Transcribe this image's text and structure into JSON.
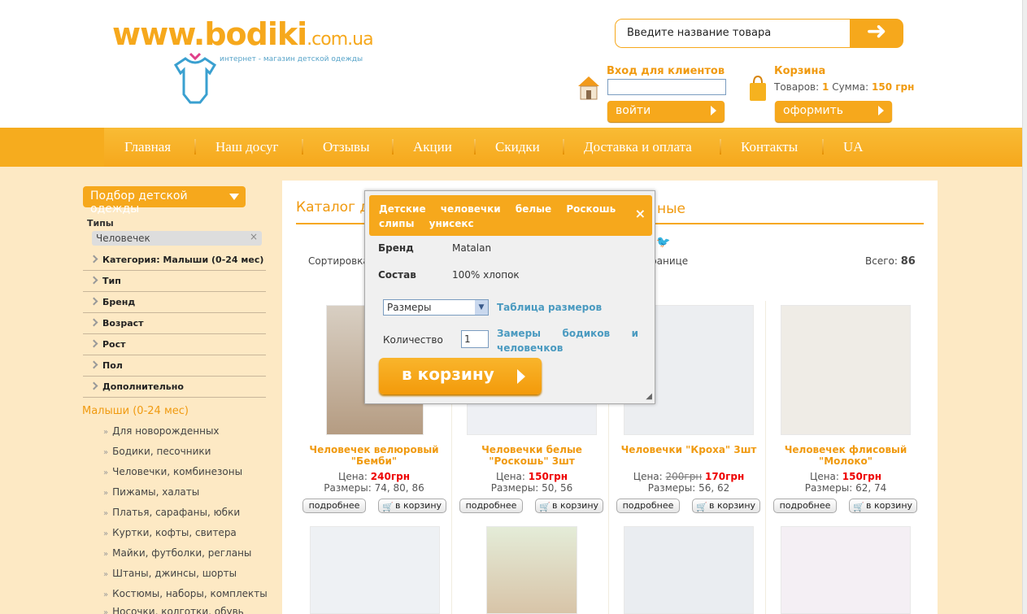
{
  "brand": {
    "logo_main": "www.bodiki",
    "logo_domain": ".com.ua",
    "logo_sub": "интернет - магазин детской одежды"
  },
  "search": {
    "placeholder": "Введите название товара"
  },
  "login": {
    "title": "Вход для клиентов",
    "button": "войти"
  },
  "cart": {
    "title": "Корзина",
    "items_label": "Товаров:",
    "items_count": "1",
    "sum_label": "Сумма:",
    "sum_value": "150 грн",
    "button": "оформить"
  },
  "nav": [
    "Главная",
    "Наш досуг",
    "Отзывы",
    "Акции",
    "Скидки",
    "Доставка и оплата",
    "Контакты",
    "UA"
  ],
  "sidebar": {
    "filter_button": "Подбор детской одежды",
    "types_label": "Типы",
    "selected_chip": "Человечек",
    "filters": [
      "Категория: Малыши (0-24 мес)",
      "Тип",
      "Бренд",
      "Возраст",
      "Рост",
      "Пол",
      "Дополнительно"
    ],
    "section_title": "Малыши (0-24 мес)",
    "subcategories": [
      "Для новорожденных",
      "Бодики, песочники",
      "Человечки, комбинезоны",
      "Пижамы, халаты",
      "Платья, сарафаны, юбки",
      "Куртки, кофты, свитера",
      "Майки, футболки, регланы",
      "Штаны, джинсы, шорты",
      "Костюмы, наборы, комплекты",
      "Носочки, колготки, обувь"
    ]
  },
  "catalog": {
    "title_left": "Каталог д",
    "title_right": "ные",
    "sort_label": "Сортировка:",
    "page_label": "ранице",
    "total_label": "Всего:",
    "total_value": "86"
  },
  "product_buttons": {
    "more": "подробнее",
    "cart": "в корзину",
    "price_label": "Цена:",
    "size_label": "Размеры:"
  },
  "products": [
    {
      "title": "Человечек велюровый \"Бемби\"",
      "price": "240грн",
      "old_price": "",
      "sizes": "74, 80, 86"
    },
    {
      "title": "Человечки белые \"Роскошь\" 3шт",
      "price": "150грн",
      "old_price": "",
      "sizes": "50, 56"
    },
    {
      "title": "Человечки \"Кроха\" 3шт",
      "price": "170грн",
      "old_price": "200грн",
      "sizes": "56, 62"
    },
    {
      "title": "Человечек флисовый \"Молоко\"",
      "price": "150грн",
      "old_price": "",
      "sizes": "62, 74"
    }
  ],
  "popup": {
    "title": "Детские человечки белые Роскошь слипы унисекс",
    "close": "×",
    "brand_label": "Бренд",
    "brand_value": "Matalan",
    "composition_label": "Состав",
    "composition_value": "100% хлопок",
    "size_select": "Размеры",
    "size_table_link": "Таблица размеров",
    "qty_label": "Количество",
    "qty_value": "1",
    "measure_link": "Замеры бодиков и человечков",
    "cart_button": "в корзину"
  },
  "colors": {
    "accent": "#f6a81c",
    "price": "#e00000",
    "link": "#4a9ac0",
    "background": "#fde9c4"
  }
}
